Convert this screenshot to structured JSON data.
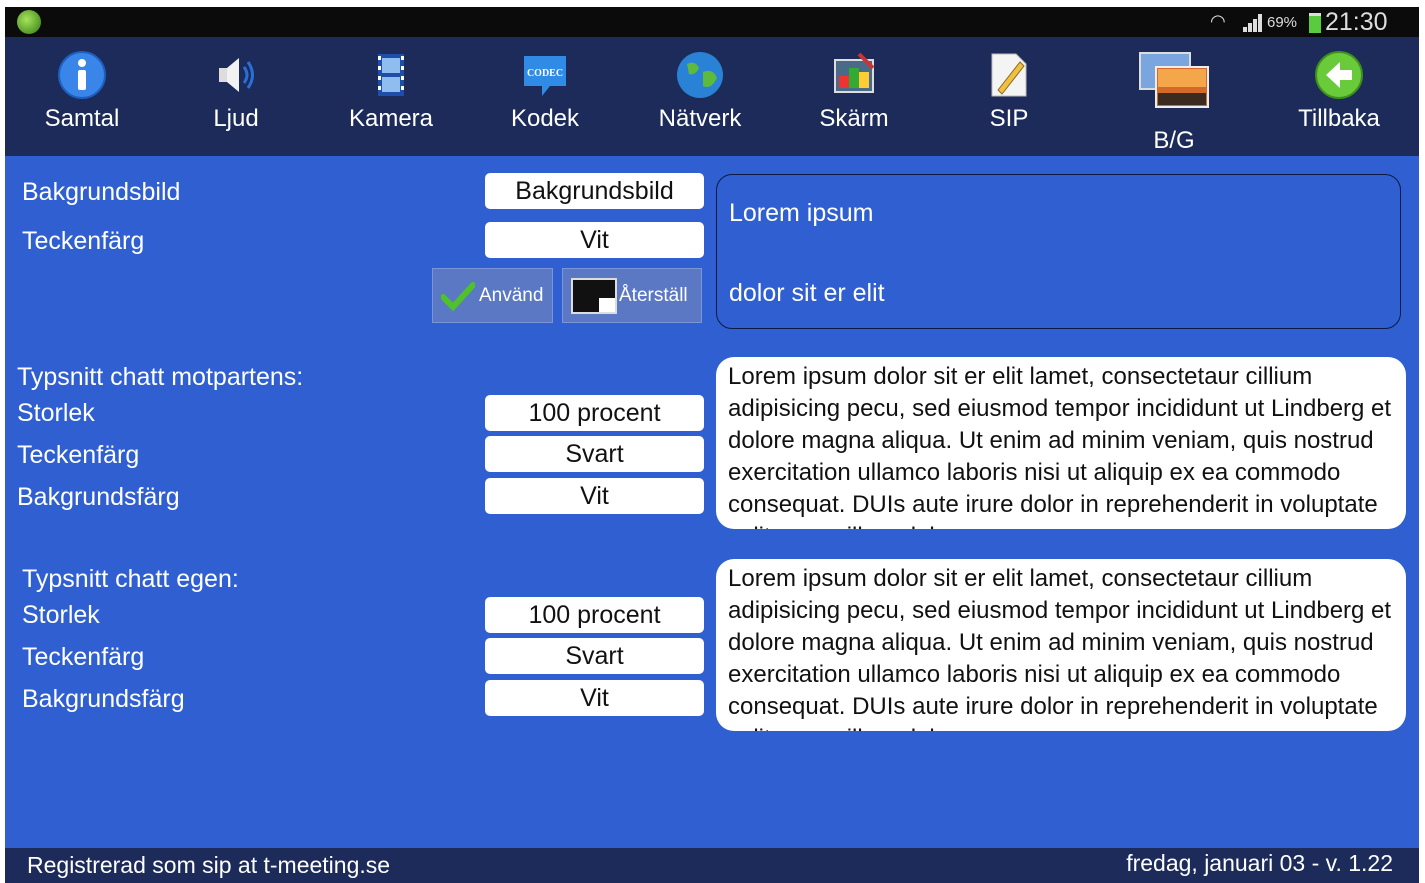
{
  "status": {
    "battery": "69%",
    "time": "21:30"
  },
  "toolbar": {
    "items": [
      {
        "label": "Samtal",
        "icon": "info-icon"
      },
      {
        "label": "Ljud",
        "icon": "speaker-icon"
      },
      {
        "label": "Kamera",
        "icon": "film-icon"
      },
      {
        "label": "Kodek",
        "icon": "codec-icon",
        "icon_text": "CODEC"
      },
      {
        "label": "Nätverk",
        "icon": "globe-icon"
      },
      {
        "label": "Skärm",
        "icon": "paint-icon"
      },
      {
        "label": "SIP",
        "icon": "document-pencil-icon"
      },
      {
        "label": "B/G",
        "icon": "background-image-icon"
      },
      {
        "label": "Tillbaka",
        "icon": "back-arrow-icon"
      }
    ]
  },
  "background": {
    "image_label": "Bakgrundsbild",
    "image_value": "Bakgrundsbild",
    "color_label": "Teckenfärg",
    "color_value": "Vit",
    "apply_label": "Använd",
    "reset_label": "Återställ",
    "preview_line1": "Lorem ipsum",
    "preview_line2": "dolor sit er elit"
  },
  "chat_other": {
    "heading": "Typsnitt chatt motpartens:",
    "size_label": "Storlek",
    "size_value": "100 procent",
    "fg_label": "Teckenfärg",
    "fg_value": "Svart",
    "bg_label": "Bakgrundsfärg",
    "bg_value": "Vit",
    "sample": "Lorem ipsum dolor sit er elit lamet, consectetaur cillium adipisicing pecu, sed eiusmod tempor incididunt ut Lindberg et dolore magna aliqua. Ut enim ad minim veniam, quis nostrud exercitation ullamco laboris nisi ut aliquip ex ea commodo consequat. DUIs aute irure dolor in reprehenderit in voluptate velit esse cillum dolore"
  },
  "chat_own": {
    "heading": "Typsnitt chatt egen:",
    "size_label": "Storlek",
    "size_value": "100 procent",
    "fg_label": "Teckenfärg",
    "fg_value": "Svart",
    "bg_label": "Bakgrundsfärg",
    "bg_value": "Vit",
    "sample": "Lorem ipsum dolor sit er elit lamet, consectetaur cillium adipisicing pecu, sed eiusmod tempor incididunt ut Lindberg et dolore magna aliqua. Ut enim ad minim veniam, quis nostrud exercitation ullamco laboris nisi ut aliquip ex ea commodo consequat. DUIs aute irure dolor in reprehenderit in voluptate velit esse cillum dolore"
  },
  "footer": {
    "left": "Registrerad som sip at t-meeting.se",
    "right": "fredag, januari 03 - v. 1.22"
  }
}
